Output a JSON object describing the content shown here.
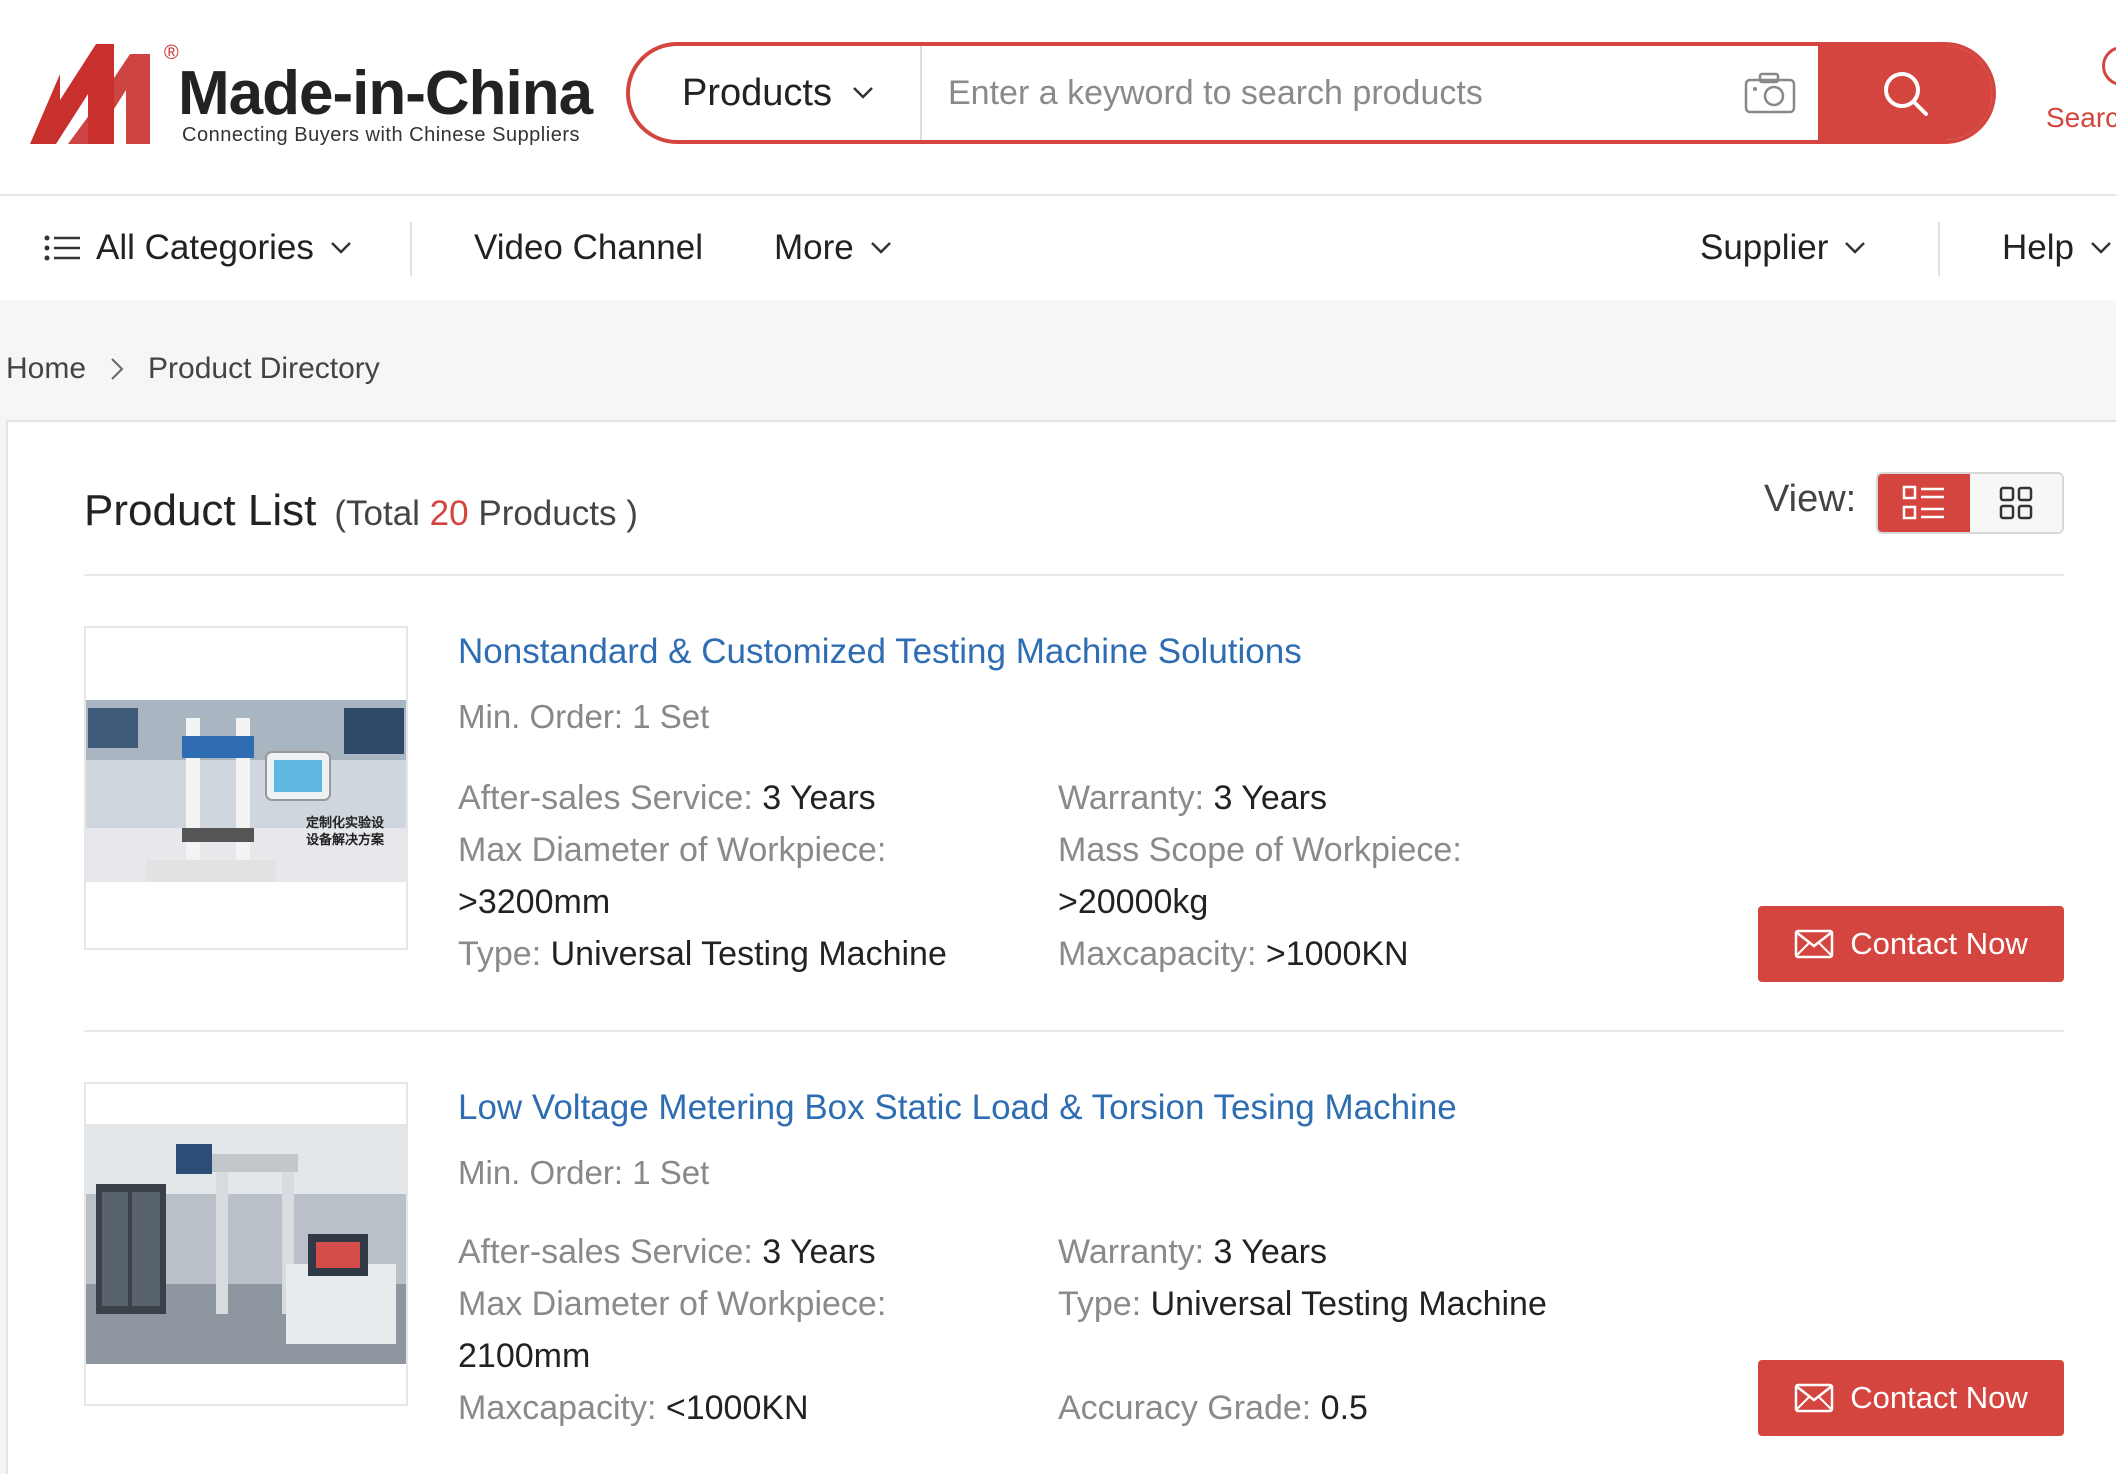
{
  "header": {
    "logo_reg": "®",
    "logo_name": "Made-in-China",
    "logo_tagline": "Connecting Buyers with Chinese Suppliers",
    "brand_color": "#d4453f",
    "search": {
      "category": "Products",
      "placeholder": "Enter a keyword to search products"
    },
    "right_label": "Searc"
  },
  "nav": {
    "all_categories": "All Categories",
    "video_channel": "Video Channel",
    "more": "More",
    "supplier": "Supplier",
    "help": "Help"
  },
  "breadcrumb": {
    "home": "Home",
    "current": "Product Directory"
  },
  "list": {
    "title": "Product List",
    "total_prefix": "(Total",
    "total_count": "20",
    "total_suffix": "Products )",
    "view_label": "View:"
  },
  "products": [
    {
      "title": "Nonstandard & Customized Testing Machine Solutions",
      "moq": "Min. Order: 1 Set",
      "thumb_text": "定制化实验设\n设备解决方案",
      "attrs": [
        {
          "key": "After-sales Service:",
          "value": "3 Years"
        },
        {
          "key": "Warranty:",
          "value": "3 Years"
        },
        {
          "key": "Max Diameter of Workpiece:",
          "value": ">3200mm"
        },
        {
          "key": "Mass Scope of Workpiece:",
          "value": ">20000kg"
        },
        {
          "key": "Type:",
          "value": "Universal Testing Machine"
        },
        {
          "key": "Maxcapacity:",
          "value": ">1000KN"
        }
      ],
      "contact": "Contact Now"
    },
    {
      "title": "Low Voltage Metering Box Static Load & Torsion Tesing Machine",
      "moq": "Min. Order: 1 Set",
      "attrs": [
        {
          "key": "After-sales Service:",
          "value": "3 Years"
        },
        {
          "key": "Warranty:",
          "value": "3 Years"
        },
        {
          "key": "Max Diameter of Workpiece:",
          "value": "2100mm"
        },
        {
          "key": "Type:",
          "value": "Universal Testing Machine"
        },
        {
          "key": "Maxcapacity:",
          "value": "<1000KN"
        },
        {
          "key": "Accuracy Grade:",
          "value": "0.5"
        }
      ],
      "contact": "Contact Now"
    }
  ]
}
